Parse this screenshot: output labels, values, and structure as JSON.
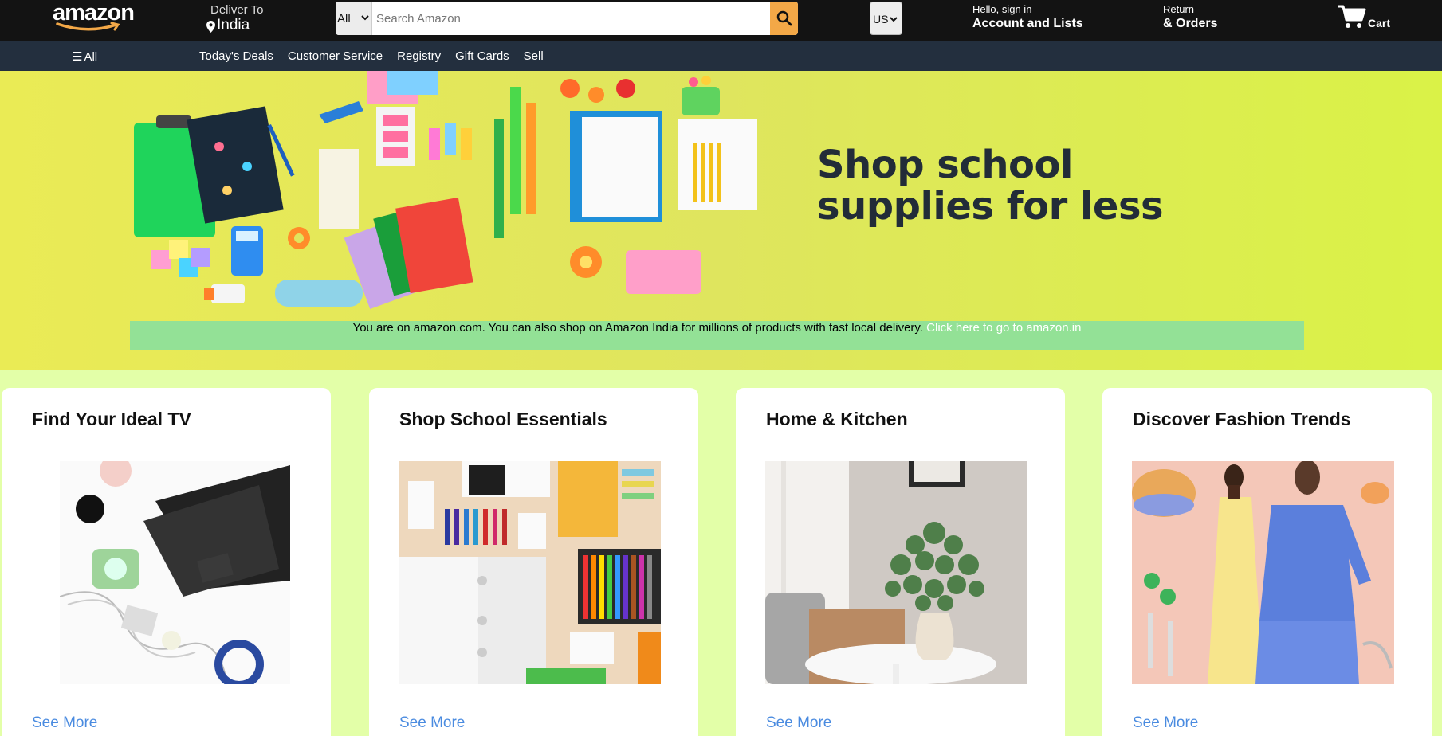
{
  "header": {
    "logo_text": "amazon",
    "deliver_label": "Deliver To",
    "deliver_country": "India",
    "search": {
      "category": "All",
      "placeholder": "Search Amazon"
    },
    "language": "US",
    "account": {
      "greeting": "Hello, sign in",
      "label": "Account and Lists"
    },
    "orders": {
      "line1": "Return",
      "line2": "& Orders"
    },
    "cart_label": "Cart"
  },
  "nav": {
    "all_label": "All",
    "links": [
      "Today's Deals",
      "Customer Service",
      "Registry",
      "Gift Cards",
      "Sell"
    ]
  },
  "hero": {
    "title_line1": "Shop school",
    "title_line2": "supplies for less",
    "notice_text": "You are on amazon.com. You can also shop on Amazon India for millions of products with fast local delivery.",
    "notice_link": "Click here to go to amazon.in"
  },
  "cards": [
    {
      "title": "Find Your Ideal TV",
      "link": "See More",
      "image": "laptop-desk-image"
    },
    {
      "title": "Shop School Essentials",
      "link": "See More",
      "image": "school-supplies-image"
    },
    {
      "title": "Home & Kitchen",
      "link": "See More",
      "image": "home-vase-image"
    },
    {
      "title": "Discover Fashion Trends",
      "link": "See More",
      "image": "fashion-models-image"
    }
  ],
  "colors": {
    "header_bg": "#131313",
    "nav_bg": "#232f3e",
    "search_button": "#f3a847",
    "page_bg": "#e3ffa8",
    "link": "#4a8be0",
    "notice_bg": "#93e196"
  }
}
